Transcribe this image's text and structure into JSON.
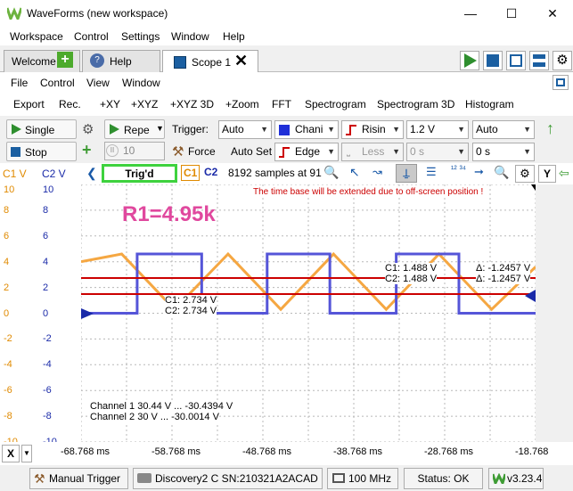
{
  "window": {
    "title": "WaveForms (new workspace)"
  },
  "menu": [
    "Workspace",
    "Control",
    "Settings",
    "Window",
    "Help"
  ],
  "tabs": {
    "welcome": "Welcome",
    "help": "Help",
    "scope": "Scope 1"
  },
  "scope_menu": [
    "File",
    "Control",
    "View",
    "Window"
  ],
  "toolbar": [
    "Export",
    "Rec.",
    "+XY",
    "+XYZ",
    "+XYZ 3D",
    "+Zoom",
    "FFT",
    "Spectrogram",
    "Spectrogram 3D",
    "Histogram"
  ],
  "controls": {
    "single": "Single",
    "stop": "Stop",
    "repeat": "Repe",
    "count": "10",
    "trigger_label": "Trigger:",
    "trigger_mode": "Auto",
    "force": "Force",
    "auto_set": "Auto Set",
    "source": "Chani",
    "condition": "Risin",
    "type": "Edge",
    "less": "Less",
    "level": "1.2 V",
    "hold_off": "0 s",
    "auto2": "Auto",
    "position": "0 s"
  },
  "plot_header": {
    "c1": "C1 V",
    "c2": "C2 V",
    "status": "Trig'd",
    "c1_btn": "C1",
    "c2_btn": "C2",
    "samples": "8192 samples at 91",
    "y_btn": "Y"
  },
  "warning": "The time base will be extended due to off-screen position !",
  "annotation": "R1=4.95k",
  "cursor_left": {
    "c1": "C1: 2.734  V",
    "c2": "C2: 2.734  V"
  },
  "cursor_right": {
    "c1": "C1: 1.488  V",
    "c2": "C2: 1.488  V",
    "d1": "Δ: -1.2457  V",
    "d2": "Δ: -1.2457  V"
  },
  "ranges": {
    "ch1": "Channel 1  30.44 V ... -30.4394 V",
    "ch2": "Channel 2  30 V ... -30.0014 V"
  },
  "y_ticks_c1": [
    "10",
    "8",
    "6",
    "4",
    "2",
    "0",
    "-2",
    "-4",
    "-6",
    "-8",
    "-10"
  ],
  "y_ticks_c2": [
    "10",
    "8",
    "6",
    "4",
    "2",
    "0",
    "-2",
    "-4",
    "-6",
    "-8",
    "-10"
  ],
  "x_ticks": [
    "-68.768 ms",
    "-58.768 ms",
    "-48.768 ms",
    "-38.768 ms",
    "-28.768 ms",
    "-18.768"
  ],
  "x_btn": "X",
  "status": {
    "manual_trigger": "Manual Trigger",
    "device": "Discovery2 C SN:210321A2ACAD",
    "clock": "100 MHz",
    "status": "Status: OK",
    "version": "v3.23.4"
  },
  "colors": {
    "c1": "#f5a742",
    "c2": "#5555d8",
    "cursor": "#cc0000",
    "accent": "#e0489e"
  },
  "chart_data": {
    "type": "line",
    "ylim": [
      -10,
      10
    ],
    "series": [
      {
        "name": "C1",
        "x": [
          -68.768,
          -64.3,
          -58.5,
          -52.6,
          -46.8,
          -41.0,
          -35.2,
          -29.4,
          -23.6,
          -18.768
        ],
        "y": [
          4.0,
          4.6,
          0.3,
          4.6,
          0.3,
          4.6,
          0.3,
          4.6,
          0.3,
          3.6
        ]
      },
      {
        "name": "C2",
        "x": [
          -68.768,
          -62.6,
          -62.6,
          -55.5,
          -55.5,
          -48.3,
          -48.3,
          -41.4,
          -41.4,
          -34.1,
          -34.1,
          -27.2,
          -27.2,
          -18.768
        ],
        "y": [
          0,
          0,
          4.6,
          4.6,
          0,
          0,
          4.6,
          4.6,
          0,
          0,
          4.6,
          4.6,
          0,
          0
        ]
      }
    ]
  }
}
